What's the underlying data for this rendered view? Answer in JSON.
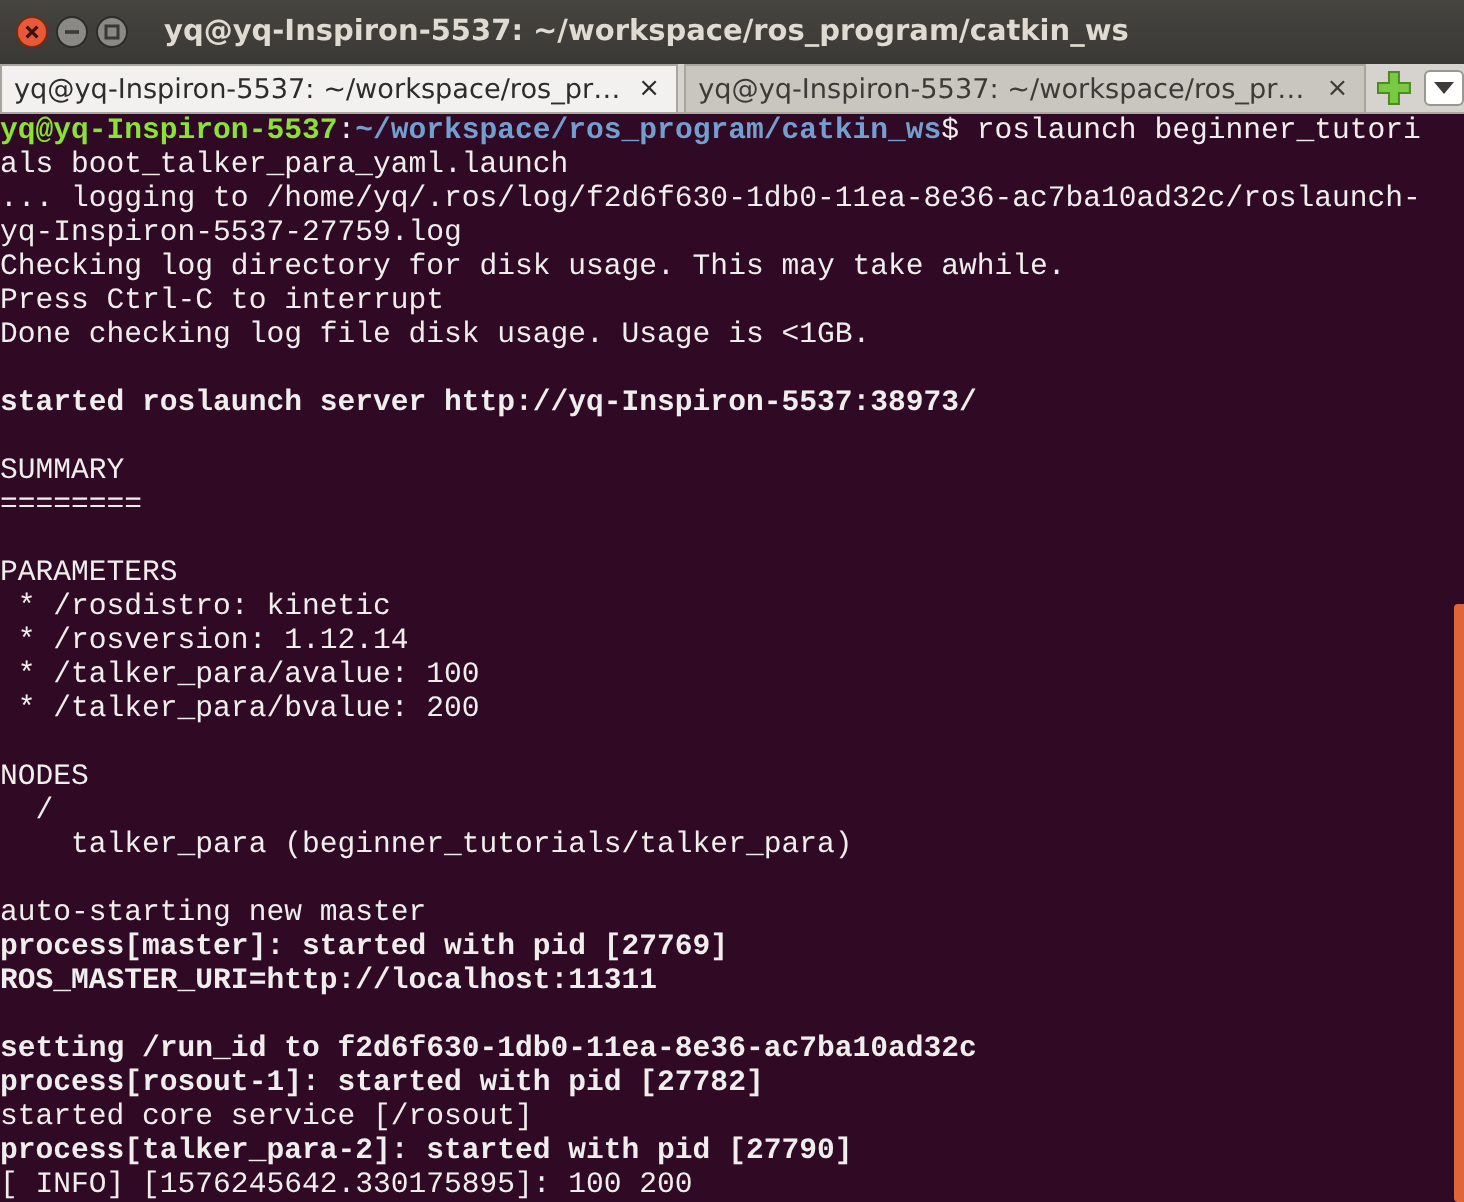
{
  "window": {
    "title": "yq@yq-Inspiron-5537: ~/workspace/ros_program/catkin_ws"
  },
  "tabs": [
    {
      "label": "yq@yq-Inspiron-5537: ~/workspace/ros_pr…",
      "close": "×",
      "selected": true
    },
    {
      "label": "yq@yq-Inspiron-5537: ~/workspace/ros_pr…",
      "close": "×",
      "selected": false
    }
  ],
  "terminal": {
    "lines": [
      {
        "kind": "text",
        "segments": [
          {
            "kind": "user",
            "text": "yq@yq-Inspiron-5537"
          },
          {
            "kind": "plain",
            "text": ":"
          },
          {
            "kind": "path",
            "text": "~/workspace/ros_program/catkin_ws"
          },
          {
            "kind": "plain",
            "text": "$ roslaunch beginner_tutori"
          }
        ]
      },
      {
        "kind": "text",
        "segments": [
          {
            "kind": "plain",
            "text": "als boot_talker_para_yaml.launch"
          }
        ]
      },
      {
        "kind": "text",
        "segments": [
          {
            "kind": "plain",
            "text": "... logging to /home/yq/.ros/log/f2d6f630-1db0-11ea-8e36-ac7ba10ad32c/roslaunch-"
          }
        ]
      },
      {
        "kind": "text",
        "segments": [
          {
            "kind": "plain",
            "text": "yq-Inspiron-5537-27759.log"
          }
        ]
      },
      {
        "kind": "text",
        "segments": [
          {
            "kind": "plain",
            "text": "Checking log directory for disk usage. This may take awhile."
          }
        ]
      },
      {
        "kind": "text",
        "segments": [
          {
            "kind": "plain",
            "text": "Press Ctrl-C to interrupt"
          }
        ]
      },
      {
        "kind": "text",
        "segments": [
          {
            "kind": "plain",
            "text": "Done checking log file disk usage. Usage is <1GB."
          }
        ]
      },
      {
        "kind": "blank"
      },
      {
        "kind": "text",
        "segments": [
          {
            "kind": "bold",
            "text": "started roslaunch server http://yq-Inspiron-5537:38973/"
          }
        ]
      },
      {
        "kind": "blank"
      },
      {
        "kind": "text",
        "segments": [
          {
            "kind": "plain",
            "text": "SUMMARY"
          }
        ]
      },
      {
        "kind": "text",
        "segments": [
          {
            "kind": "plain",
            "text": "========"
          }
        ]
      },
      {
        "kind": "blank"
      },
      {
        "kind": "text",
        "segments": [
          {
            "kind": "plain",
            "text": "PARAMETERS"
          }
        ]
      },
      {
        "kind": "text",
        "segments": [
          {
            "kind": "plain",
            "text": " * /rosdistro: kinetic"
          }
        ]
      },
      {
        "kind": "text",
        "segments": [
          {
            "kind": "plain",
            "text": " * /rosversion: 1.12.14"
          }
        ]
      },
      {
        "kind": "text",
        "segments": [
          {
            "kind": "plain",
            "text": " * /talker_para/avalue: 100"
          }
        ]
      },
      {
        "kind": "text",
        "segments": [
          {
            "kind": "plain",
            "text": " * /talker_para/bvalue: 200"
          }
        ]
      },
      {
        "kind": "blank"
      },
      {
        "kind": "text",
        "segments": [
          {
            "kind": "plain",
            "text": "NODES"
          }
        ]
      },
      {
        "kind": "text",
        "segments": [
          {
            "kind": "plain",
            "text": "  /"
          }
        ]
      },
      {
        "kind": "text",
        "segments": [
          {
            "kind": "plain",
            "text": "    talker_para (beginner_tutorials/talker_para)"
          }
        ]
      },
      {
        "kind": "blank"
      },
      {
        "kind": "text",
        "segments": [
          {
            "kind": "plain",
            "text": "auto-starting new master"
          }
        ]
      },
      {
        "kind": "text",
        "segments": [
          {
            "kind": "bold",
            "text": "process[master]: started with pid [27769]"
          }
        ]
      },
      {
        "kind": "text",
        "segments": [
          {
            "kind": "bold",
            "text": "ROS_MASTER_URI=http://localhost:11311"
          }
        ]
      },
      {
        "kind": "blank"
      },
      {
        "kind": "text",
        "segments": [
          {
            "kind": "bold",
            "text": "setting /run_id to f2d6f630-1db0-11ea-8e36-ac7ba10ad32c"
          }
        ]
      },
      {
        "kind": "text",
        "segments": [
          {
            "kind": "bold",
            "text": "process[rosout-1]: started with pid [27782]"
          }
        ]
      },
      {
        "kind": "text",
        "segments": [
          {
            "kind": "plain",
            "text": "started core service [/rosout]"
          }
        ]
      },
      {
        "kind": "text",
        "segments": [
          {
            "kind": "bold",
            "text": "process[talker_para-2]: started with pid [27790]"
          }
        ]
      },
      {
        "kind": "text",
        "segments": [
          {
            "kind": "plain",
            "text": "[ INFO] [1576245642.330175895]: 100 200"
          }
        ]
      }
    ]
  }
}
